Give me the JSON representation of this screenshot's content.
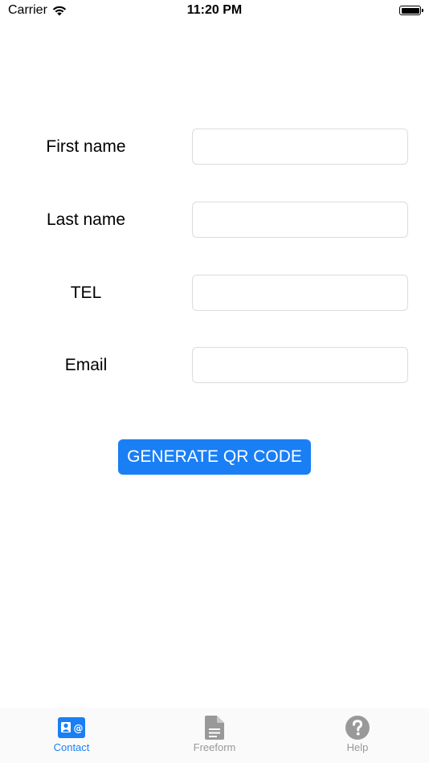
{
  "status_bar": {
    "carrier": "Carrier",
    "time": "11:20 PM"
  },
  "form": {
    "fields": [
      {
        "label": "First name",
        "value": "",
        "placeholder": ""
      },
      {
        "label": "Last name",
        "value": "",
        "placeholder": ""
      },
      {
        "label": "TEL",
        "value": "",
        "placeholder": ""
      },
      {
        "label": "Email",
        "value": "",
        "placeholder": ""
      }
    ],
    "generate_label": "GENERATE QR CODE"
  },
  "tab_bar": {
    "tabs": [
      {
        "label": "Contact",
        "icon": "contact-card-icon",
        "active": true
      },
      {
        "label": "Freeform",
        "icon": "document-icon",
        "active": false
      },
      {
        "label": "Help",
        "icon": "question-icon",
        "active": false
      }
    ]
  },
  "colors": {
    "accent": "#1a7ff5",
    "inactive_tab": "#999999",
    "input_border": "#dcdcdc"
  }
}
